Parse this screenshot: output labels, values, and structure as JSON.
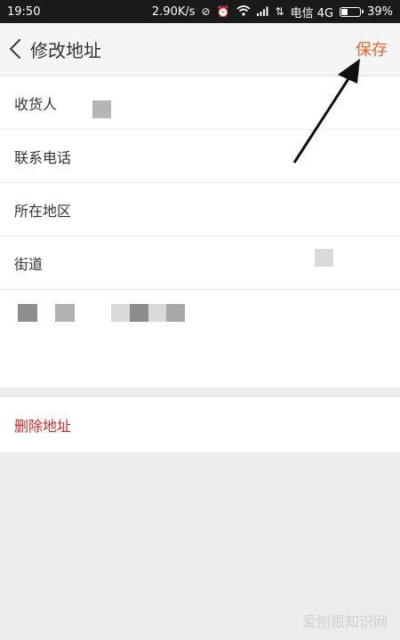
{
  "status_bar": {
    "time": "19:50",
    "speed": "2.90K/s",
    "network": "电信 4G",
    "battery": "39%",
    "battery_level": 0.39
  },
  "header": {
    "title": "修改地址",
    "save_label": "保存"
  },
  "form": {
    "fields": [
      {
        "label": "收货人"
      },
      {
        "label": "联系电话"
      },
      {
        "label": "所在地区"
      },
      {
        "label": "街道"
      }
    ]
  },
  "actions": {
    "delete_label": "删除地址"
  },
  "watermark": "爱刨根知识网",
  "colors": {
    "accent": "#e5652a",
    "danger": "#d02a2a",
    "background": "#ececec"
  }
}
